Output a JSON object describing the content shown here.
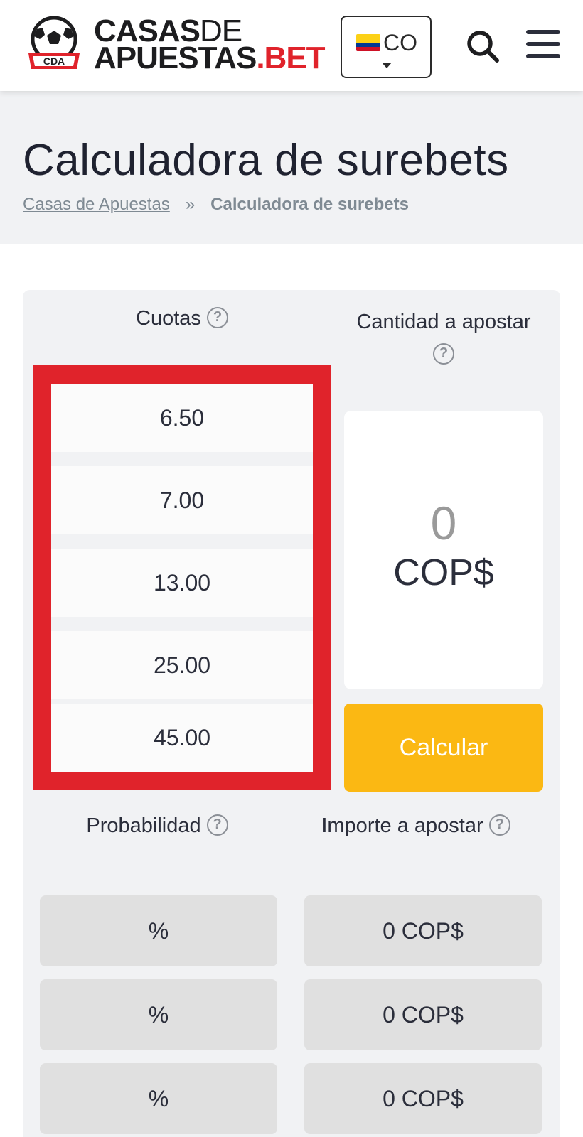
{
  "header": {
    "logo": {
      "badge_text": "CDA",
      "line1_bold": "CASAS",
      "line1_thin": "DE",
      "line2_main": "APUESTAS",
      "line2_accent": ".BET"
    },
    "country": {
      "code": "CO",
      "flag": "colombia-flag"
    },
    "search_icon": "search-icon",
    "menu_icon": "hamburger-menu-icon"
  },
  "title_section": {
    "title": "Calculadora de surebets",
    "breadcrumb": {
      "home": "Casas de Apuestas",
      "separator": "»",
      "current": "Calculadora de surebets"
    }
  },
  "calculator": {
    "odds_header": "Cuotas",
    "stake_header": "Cantidad a apostar",
    "help_icon": "?",
    "odds": [
      "6.50",
      "7.00",
      "13.00",
      "25.00",
      "45.00"
    ],
    "stake": {
      "value": "0",
      "currency": "COP$"
    },
    "calculate_label": "Calcular",
    "probability_header": "Probabilidad",
    "amount_header": "Importe a apostar",
    "results": [
      {
        "probability": "%",
        "amount": "0 COP$"
      },
      {
        "probability": "%",
        "amount": "0 COP$"
      },
      {
        "probability": "%",
        "amount": "0 COP$"
      }
    ]
  },
  "colors": {
    "brand_red": "#e0232b",
    "calculate_yellow": "#fbb813",
    "panel_gray": "#f1f2f4",
    "result_gray": "#e0e0e0"
  }
}
